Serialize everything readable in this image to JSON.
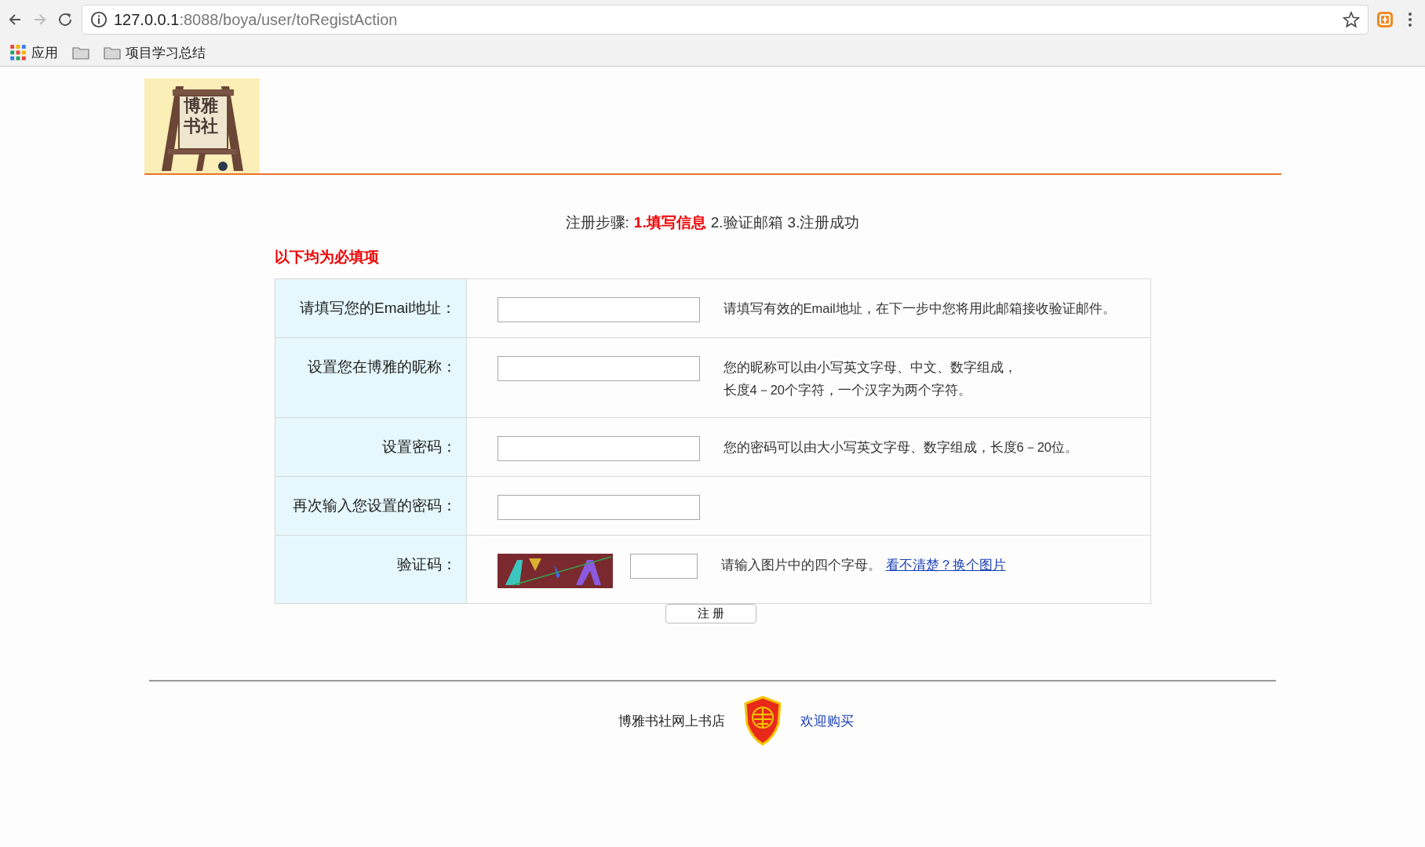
{
  "browser": {
    "back": {
      "disabled": false
    },
    "forward": {
      "disabled": true
    },
    "address": {
      "host": "127.0.0.1",
      "path": ":8088/boya/user/toRegistAction"
    },
    "bookmarks": [
      {
        "kind": "apps",
        "label": "应用"
      },
      {
        "kind": "folder"
      },
      {
        "kind": "folder",
        "label": "项目学习总结"
      }
    ]
  },
  "logo": {
    "lines": [
      "博雅",
      "书社"
    ]
  },
  "steps": {
    "label": "注册步骤:",
    "items": [
      {
        "text": "1.填写信息",
        "selected": true
      },
      {
        "text": "2.验证邮箱",
        "selected": false
      },
      {
        "text": "3.注册成功",
        "selected": false
      }
    ]
  },
  "required_note": "以下均为必填项",
  "form": {
    "rows": [
      {
        "kind": "text",
        "label": "请填写您的Email地址：",
        "hint": [
          "请填写有效的Email地址，在下一步中您将用此邮箱接收验证邮件。"
        ]
      },
      {
        "kind": "text",
        "label": "设置您在博雅的昵称：",
        "hint": [
          "您的昵称可以由小写英文字母、中文、数字组成，",
          "长度4－20个字符，一个汉字为两个字符。"
        ]
      },
      {
        "kind": "password",
        "label": "设置密码：",
        "hint": [
          "您的密码可以由大小写英文字母、数字组成，长度6－20位。"
        ]
      },
      {
        "kind": "password",
        "label": "再次输入您设置的密码："
      },
      {
        "kind": "captcha",
        "label": "验证码：",
        "hint": [
          "请输入图片中的四个字母。"
        ],
        "link": "看不清楚？换个图片"
      }
    ]
  },
  "submit": "注 册",
  "footer": {
    "text": "博雅书社网上书店",
    "link": "欢迎购买"
  }
}
